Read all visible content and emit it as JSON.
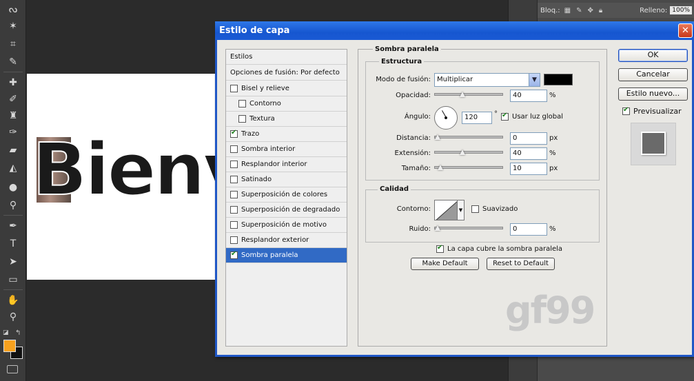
{
  "layers_panel": {
    "lock_label": "Bloq.:",
    "fill_label": "Relleno:",
    "fill_value": "100%"
  },
  "canvas": {
    "document_text": "Bienv"
  },
  "colors": {
    "foreground": "#f7a11e",
    "background": "#111111",
    "dialog_title_bar": "#1656d0",
    "selected_item": "#316ac5"
  },
  "dialog": {
    "title": "Estilo de capa",
    "close_label": "✕",
    "styles_list": {
      "header": "Estilos",
      "blending_options": "Opciones de fusión: Por defecto",
      "items": [
        {
          "label": "Bisel y relieve",
          "checked": false,
          "indent": false
        },
        {
          "label": "Contorno",
          "checked": false,
          "indent": true
        },
        {
          "label": "Textura",
          "checked": false,
          "indent": true
        },
        {
          "label": "Trazo",
          "checked": true,
          "indent": false
        },
        {
          "label": "Sombra interior",
          "checked": false,
          "indent": false
        },
        {
          "label": "Resplandor interior",
          "checked": false,
          "indent": false
        },
        {
          "label": "Satinado",
          "checked": false,
          "indent": false
        },
        {
          "label": "Superposición de colores",
          "checked": false,
          "indent": false
        },
        {
          "label": "Superposición de degradado",
          "checked": false,
          "indent": false
        },
        {
          "label": "Superposición de motivo",
          "checked": false,
          "indent": false
        },
        {
          "label": "Resplandor exterior",
          "checked": false,
          "indent": false
        },
        {
          "label": "Sombra paralela",
          "checked": true,
          "indent": false,
          "selected": true
        }
      ]
    },
    "drop_shadow": {
      "section_title": "Sombra paralela",
      "structure_title": "Estructura",
      "blend_mode_label": "Modo de fusión:",
      "blend_mode_value": "Multiplicar",
      "shadow_color": "#000000",
      "opacity_label": "Opacidad:",
      "opacity_value": "40",
      "opacity_unit": "%",
      "opacity_fraction": 0.4,
      "angle_label": "Ángulo:",
      "angle_value": "120",
      "angle_unit": "°",
      "global_light_label": "Usar luz global",
      "global_light_checked": true,
      "distance_label": "Distancia:",
      "distance_value": "0",
      "distance_unit": "px",
      "distance_fraction": 0.0,
      "spread_label": "Extensión:",
      "spread_value": "40",
      "spread_unit": "%",
      "spread_fraction": 0.4,
      "size_label": "Tamaño:",
      "size_value": "10",
      "size_unit": "px",
      "size_fraction": 0.05,
      "quality_title": "Calidad",
      "contour_label": "Contorno:",
      "antialiased_label": "Suavizado",
      "antialiased_checked": false,
      "noise_label": "Ruido:",
      "noise_value": "0",
      "noise_unit": "%",
      "noise_fraction": 0.0,
      "knockout_label": "La capa cubre la sombra paralela",
      "knockout_checked": true,
      "make_default_label": "Make Default",
      "reset_default_label": "Reset to Default"
    },
    "buttons": {
      "ok": "OK",
      "cancel": "Cancelar",
      "new_style": "Estilo nuevo...",
      "preview_label": "Previsualizar",
      "preview_checked": true
    },
    "watermark": "gf99"
  }
}
